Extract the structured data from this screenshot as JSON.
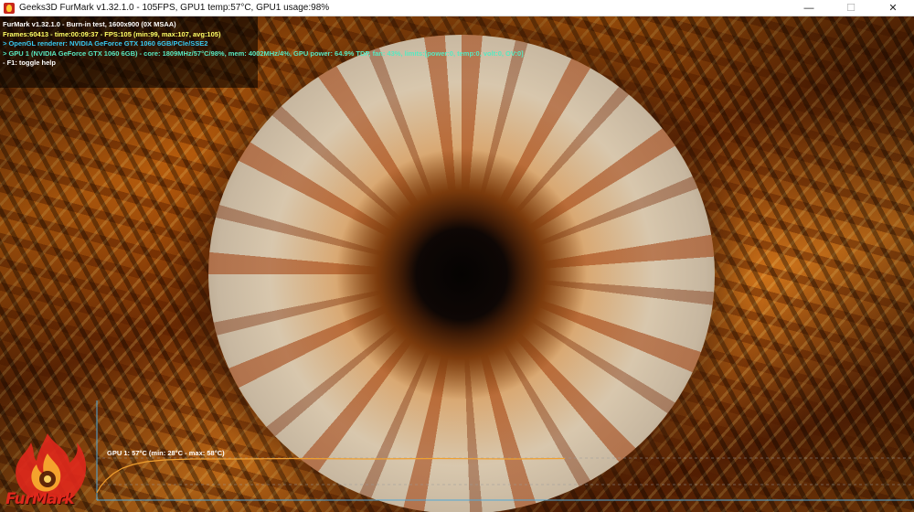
{
  "window": {
    "title": "Geeks3D FurMark v1.32.1.0 - 105FPS, GPU1 temp:57°C, GPU1 usage:98%",
    "minimize_glyph": "—",
    "maximize_glyph": "☐",
    "close_glyph": "✕",
    "icon": "furmark-app-icon"
  },
  "osd": {
    "line1": "FurMark v1.32.1.0 - Burn-in test, 1600x900 (0X MSAA)",
    "line2": "Frames:60413 - time:00:09:37 - FPS:105 (min:99, max:107, avg:105)",
    "line3": "> OpenGL renderer: NVIDIA GeForce GTX 1060 6GB/PCIe/SSE2",
    "line4": "> GPU 1 (NVIDIA GeForce GTX 1060 6GB) - core: 1809MHz/57°C/98%, mem: 4002MHz/4%, GPU power: 64.9% TDP, fan: 43%, limits:[power:0, temp:0, volt:0, OV:0]",
    "line5": "- F1: toggle help"
  },
  "temp_graph": {
    "label": "GPU 1: 57°C (min: 28°C - max: 58°C)",
    "current_c": 57,
    "min_c": 28,
    "max_c": 58,
    "curve_color": "#f0a030",
    "axis_color": "#4fa8d8"
  },
  "logo": {
    "text": "FurMark",
    "color": "#e0281c",
    "icon": "furmark-flame-logo"
  },
  "colors": {
    "osd_white": "#ffffff",
    "osd_yellow": "#ffff66",
    "osd_cyan": "#38c8f0",
    "osd_green": "#58e8c0"
  }
}
